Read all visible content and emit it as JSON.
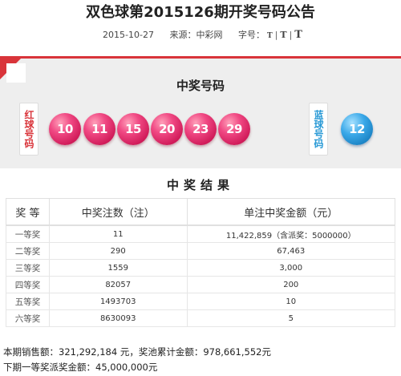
{
  "header": {
    "title": "双色球第2015126期开奖号码公告",
    "date": "2015-10-27",
    "source": "来源：中彩网",
    "font_size_label": "字号：",
    "font_sizes": [
      "T",
      "T",
      "T"
    ],
    "separator": "|"
  },
  "draw": {
    "section_title": "中奖号码",
    "red_label": "红球号码",
    "blue_label": "蓝球号码",
    "red_balls": [
      "10",
      "11",
      "15",
      "20",
      "23",
      "29"
    ],
    "blue_balls": [
      "12"
    ],
    "colors": {
      "red": "#e91e63",
      "blue": "#2a9ad6",
      "accent": "#d9343a"
    }
  },
  "results": {
    "section_title": "中奖结果",
    "headers": [
      "奖 等",
      "中奖注数（注）",
      "单注中奖金额（元）"
    ],
    "rows": [
      {
        "level": "一等奖",
        "count": "11",
        "amount": "11,422,859（含派奖：5000000）"
      },
      {
        "level": "二等奖",
        "count": "290",
        "amount": "67,463"
      },
      {
        "level": "三等奖",
        "count": "1559",
        "amount": "3,000"
      },
      {
        "level": "四等奖",
        "count": "82057",
        "amount": "200"
      },
      {
        "level": "五等奖",
        "count": "1493703",
        "amount": "10"
      },
      {
        "level": "六等奖",
        "count": "8630093",
        "amount": "5"
      }
    ]
  },
  "footer": {
    "line1": "本期销售额：321,292,184 元，奖池累计金额：978,661,552元",
    "line2": "下期一等奖派奖金额：45,000,000元"
  }
}
